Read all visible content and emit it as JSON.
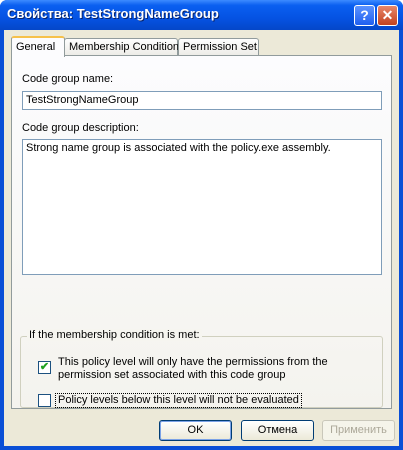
{
  "window": {
    "title": "Свойства: TestStrongNameGroup",
    "help_glyph": "?",
    "close_glyph": "✕"
  },
  "tabs": [
    {
      "label": "General",
      "active": true
    },
    {
      "label": "Membership Condition",
      "active": false
    },
    {
      "label": "Permission Set",
      "active": false
    }
  ],
  "general": {
    "name_label": "Code group name:",
    "name_value": "TestStrongNameGroup",
    "description_label": "Code group description:",
    "description_value": "Strong name group is associated with the policy.exe assembly.",
    "condition_group_caption": "If the membership condition is met:",
    "checkbox1_label_line1": "This policy level will only have the permissions from the",
    "checkbox1_label_line2": "permission set associated with this code group",
    "checkbox1_checked": true,
    "checkbox2_label": "Policy levels below this level will not be evaluated",
    "checkbox2_checked": false
  },
  "buttons": {
    "ok": "OK",
    "cancel": "Отмена",
    "apply": "Применить"
  },
  "colors": {
    "titlebar": "#0553e3",
    "dialog": "#ece9d8"
  }
}
